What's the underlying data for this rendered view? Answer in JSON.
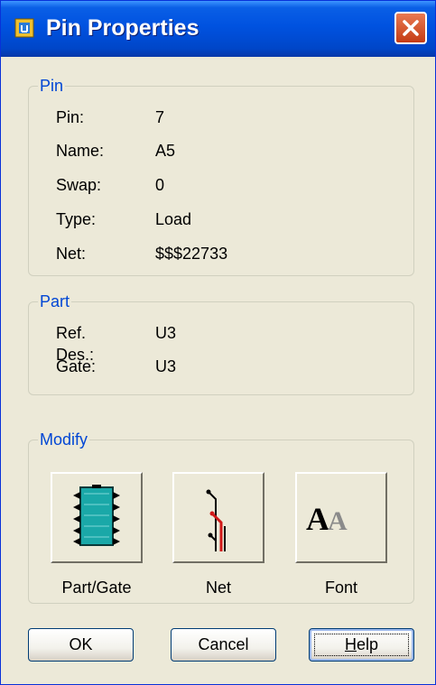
{
  "window": {
    "title": "Pin Properties"
  },
  "pin_group": {
    "legend": "Pin",
    "rows": [
      {
        "label": "Pin:",
        "value": "7"
      },
      {
        "label": "Name:",
        "value": "A5"
      },
      {
        "label": "Swap:",
        "value": "0"
      },
      {
        "label": "Type:",
        "value": "Load"
      },
      {
        "label": "Net:",
        "value": "$$$22733"
      }
    ]
  },
  "part_group": {
    "legend": "Part",
    "rows": [
      {
        "label": "Ref. Des.:",
        "value": "U3"
      },
      {
        "label": "Gate:",
        "value": "U3"
      }
    ]
  },
  "modify_group": {
    "legend": "Modify",
    "buttons": [
      {
        "label": "Part/Gate",
        "icon": "chip-icon"
      },
      {
        "label": "Net",
        "icon": "net-traces-icon"
      },
      {
        "label": "Font",
        "icon": "font-aa-icon"
      }
    ]
  },
  "buttons": {
    "ok": "OK",
    "cancel": "Cancel",
    "help_prefix": "H",
    "help_rest": "elp"
  }
}
